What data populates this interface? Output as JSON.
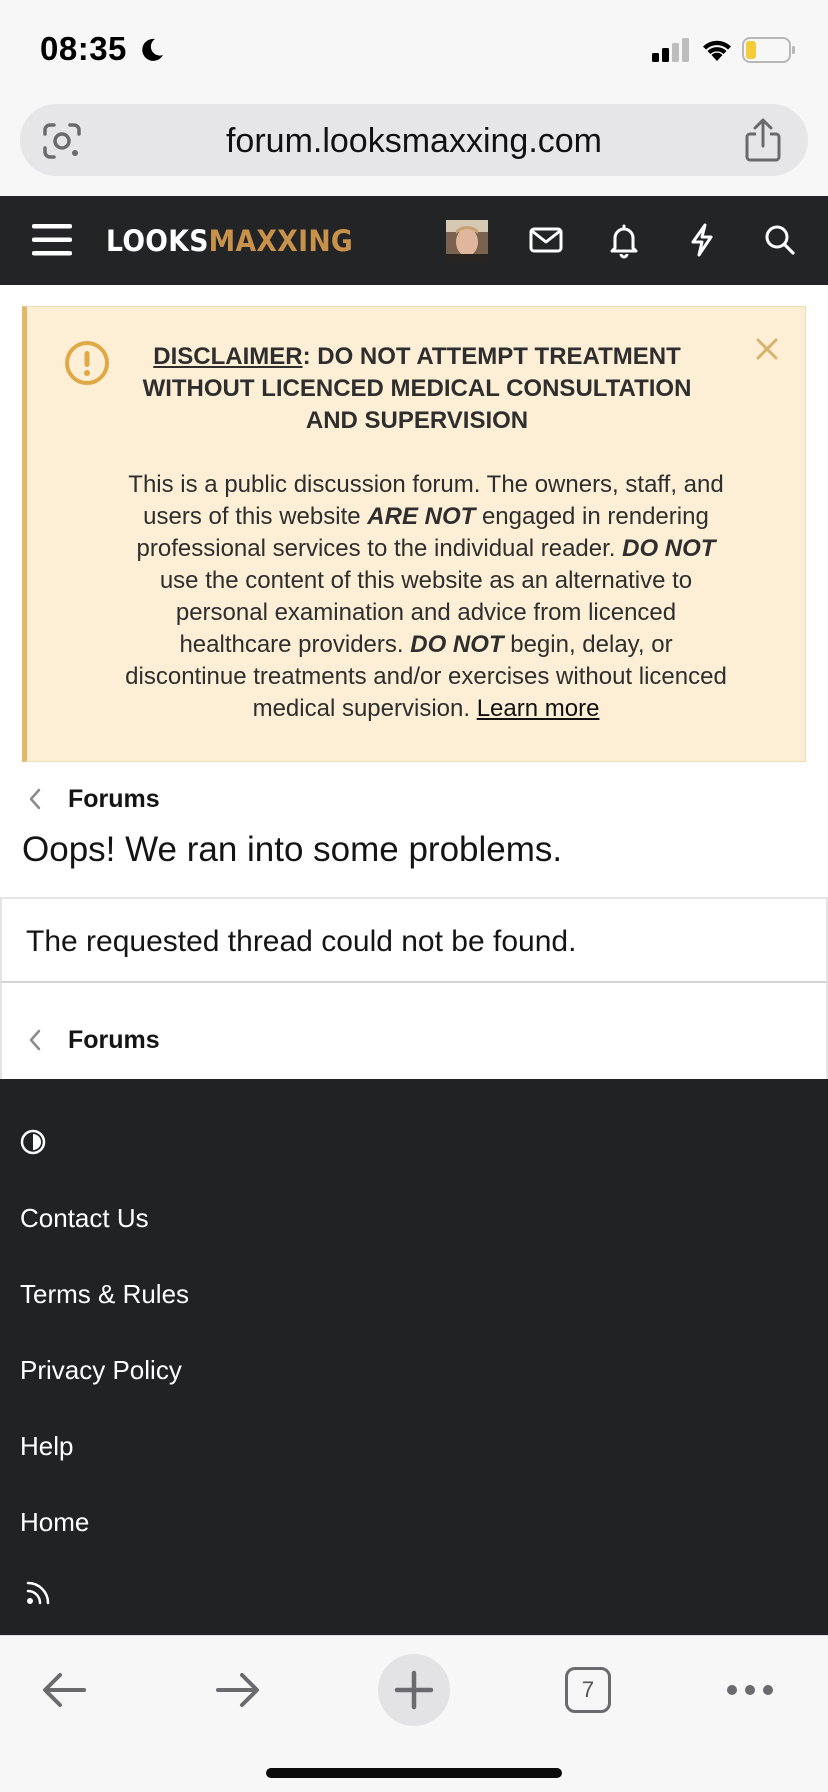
{
  "status_bar": {
    "time": "08:35",
    "icons": [
      "moon-icon",
      "cellular-signal-icon",
      "wifi-icon",
      "battery-icon"
    ]
  },
  "browser": {
    "url": "forum.looksmaxxing.com",
    "tab_count": "7"
  },
  "nav": {
    "logo_part1": "LOOKS",
    "logo_part2": "MAXXING",
    "icons": [
      "hamburger-menu-icon",
      "avatar",
      "envelope-icon",
      "bell-icon",
      "lightning-icon",
      "search-icon"
    ]
  },
  "disclaimer": {
    "title_label": "DISCLAIMER",
    "title_rest": ": DO NOT ATTEMPT TREATMENT WITHOUT LICENCED MEDICAL CONSULTATION AND SUPERVISION",
    "body_1": "This is a public discussion forum. The owners, staff, and users of this website ",
    "body_2": "ARE NOT",
    "body_3": " engaged in rendering professional services to the individual reader. ",
    "body_4": "DO NOT",
    "body_5": " use the content of this website as an alternative to personal examination and advice from licenced healthcare providers. ",
    "body_6": "DO NOT",
    "body_7": " begin, delay, or discontinue treatments and/or exercises without licenced medical supervision. ",
    "learn_more": "Learn more"
  },
  "breadcrumb": {
    "label": "Forums"
  },
  "page_title": "Oops! We ran into some problems.",
  "error_message": "The requested thread could not be found.",
  "footer": {
    "links": [
      "Contact Us",
      "Terms & Rules",
      "Privacy Policy",
      "Help",
      "Home"
    ]
  },
  "colors": {
    "nav_bg": "#222426",
    "logo_accent": "#c9924a",
    "notice_bg": "#fcefd6",
    "notice_border": "#e2b866",
    "footer_bg": "#212223"
  }
}
